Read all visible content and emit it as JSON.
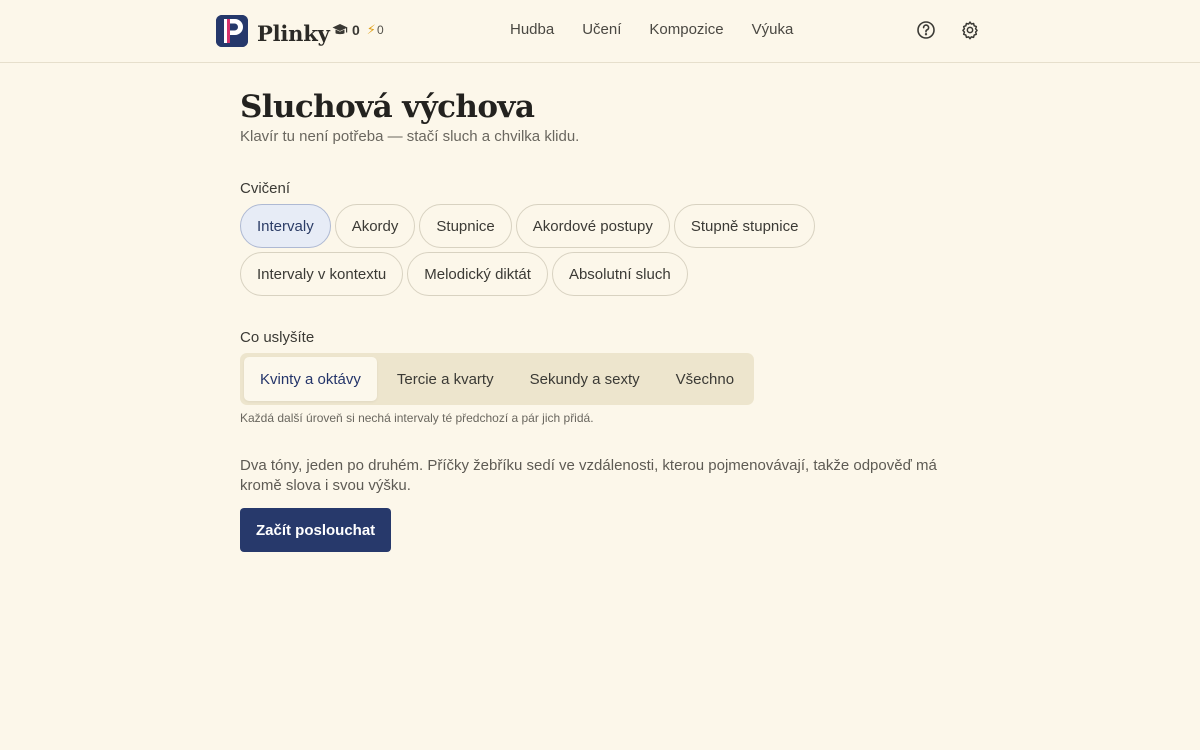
{
  "header": {
    "brand": "Plinky",
    "streak_value": "0",
    "energy_value": "0",
    "nav": [
      "Hudba",
      "Učení",
      "Kompozice",
      "Výuka"
    ]
  },
  "page": {
    "title": "Sluchová výchova",
    "subtitle": "Klavír tu není potřeba — stačí sluch a chvilka klidu."
  },
  "exercises": {
    "label": "Cvičení",
    "items": [
      "Intervaly",
      "Akordy",
      "Stupnice",
      "Akordové postupy",
      "Stupně stupnice",
      "Intervaly v kontextu",
      "Melodický diktát",
      "Absolutní sluch"
    ],
    "selected": "Intervaly"
  },
  "levels": {
    "label": "Co uslyšíte",
    "items": [
      "Kvinty a oktávy",
      "Tercie a kvarty",
      "Sekundy a sexty",
      "Všechno"
    ],
    "selected": "Kvinty a oktávy",
    "hint": "Každá další úroveň si nechá intervaly té předchozí a pár jich přidá."
  },
  "description": "Dva tóny, jeden po druhém. Příčky žebříku sedí ve vzdálenosti, kterou pojmenovávají, takže odpověď má kromě slova i svou výšku.",
  "cta_label": "Začít poslouchat",
  "icons": {
    "streak": "graduation-cap-icon",
    "energy": "lightning-icon",
    "help": "help-circle-icon",
    "settings": "gear-icon"
  },
  "colors": {
    "accent": "#27396b",
    "logo_accent": "#d6336c",
    "background": "#fcf7ea"
  }
}
